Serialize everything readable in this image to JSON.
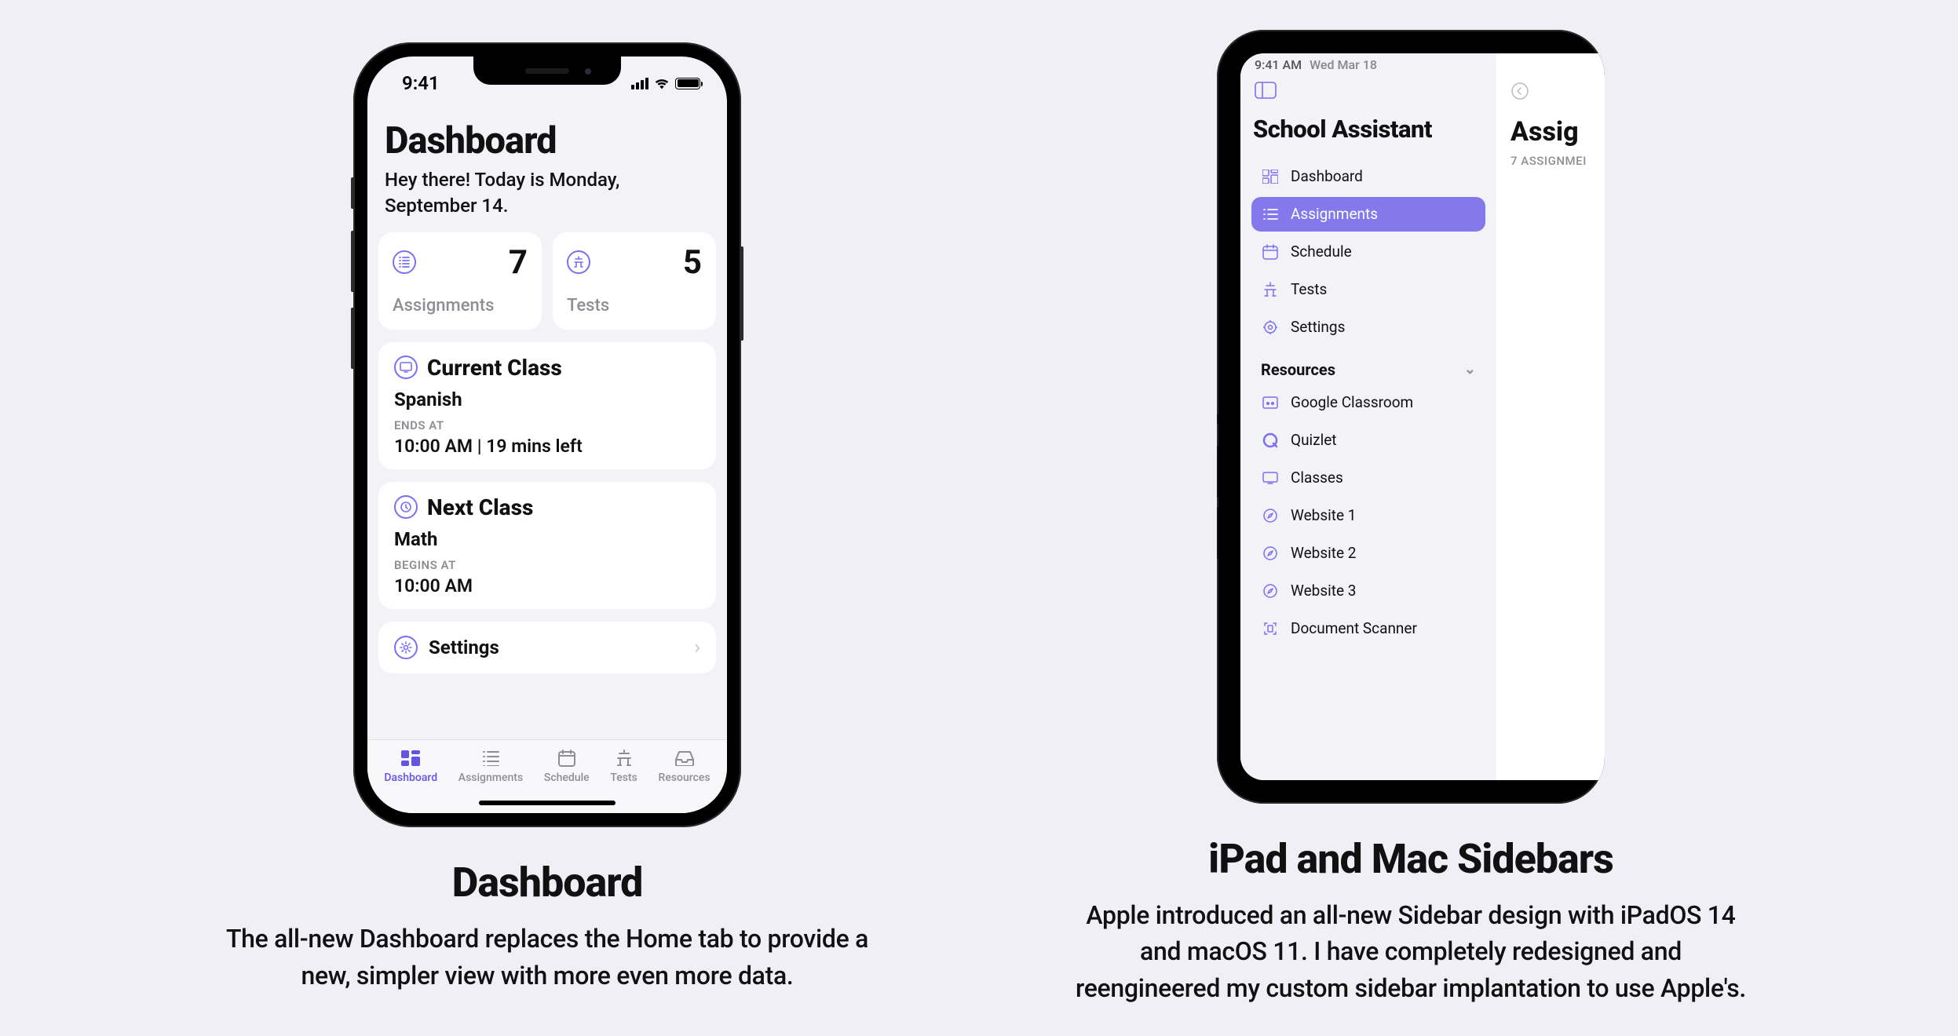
{
  "iphone": {
    "status_time": "9:41",
    "title": "Dashboard",
    "subtitle": "Hey there! Today is Monday, September 14.",
    "stats": [
      {
        "value": "7",
        "label": "Assignments"
      },
      {
        "value": "5",
        "label": "Tests"
      }
    ],
    "current": {
      "heading": "Current Class",
      "class": "Spanish",
      "meta_label": "ENDS AT",
      "meta_value": "10:00 AM | 19 mins left"
    },
    "next": {
      "heading": "Next Class",
      "class": "Math",
      "meta_label": "BEGINS AT",
      "meta_value": "10:00 AM"
    },
    "settings_label": "Settings",
    "tabs": [
      {
        "label": "Dashboard"
      },
      {
        "label": "Assignments"
      },
      {
        "label": "Schedule"
      },
      {
        "label": "Tests"
      },
      {
        "label": "Resources"
      }
    ]
  },
  "ipad": {
    "status_time": "9:41 AM",
    "status_date": "Wed Mar 18",
    "title": "School Assistant",
    "items": [
      {
        "label": "Dashboard"
      },
      {
        "label": "Assignments"
      },
      {
        "label": "Schedule"
      },
      {
        "label": "Tests"
      },
      {
        "label": "Settings"
      }
    ],
    "resources_heading": "Resources",
    "resources": [
      {
        "label": "Google Classroom"
      },
      {
        "label": "Quizlet"
      },
      {
        "label": "Classes"
      },
      {
        "label": "Website 1"
      },
      {
        "label": "Website 2"
      },
      {
        "label": "Website 3"
      },
      {
        "label": "Document Scanner"
      }
    ],
    "content_title": "Assig",
    "content_meta": "7 ASSIGNMEI"
  },
  "features": [
    {
      "title": "Dashboard",
      "desc": "The all-new Dashboard replaces the Home tab to provide a new, simpler view with more even more data."
    },
    {
      "title": "iPad and Mac Sidebars",
      "desc": "Apple introduced an all-new Sidebar design with iPadOS 14 and macOS 11. I have completely redesigned and reengineered my custom sidebar implantation to use Apple's."
    }
  ]
}
